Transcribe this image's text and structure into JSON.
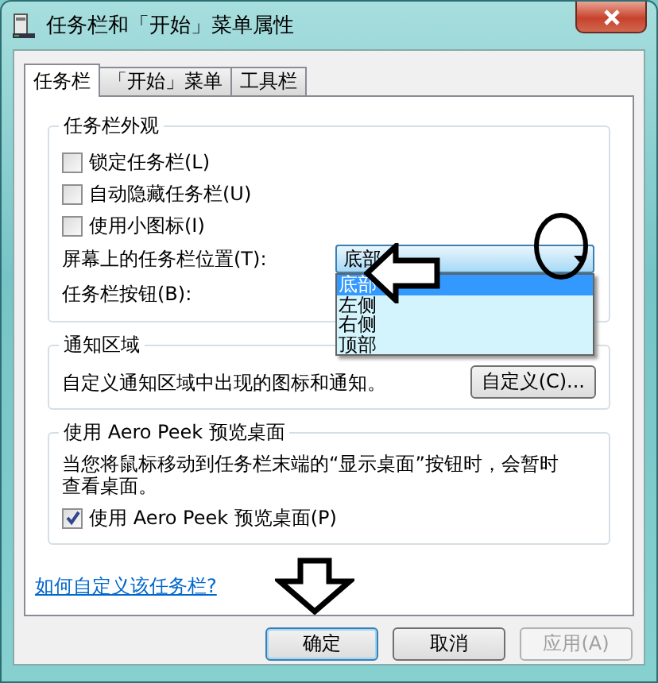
{
  "window": {
    "title": "任务栏和「开始」菜单属性"
  },
  "tabs": [
    {
      "label": "任务栏",
      "selected": true
    },
    {
      "label": "「开始」菜单",
      "selected": false
    },
    {
      "label": "工具栏",
      "selected": false
    }
  ],
  "appearance": {
    "title": "任务栏外观",
    "checkboxes": [
      {
        "label": "锁定任务栏(L)",
        "checked": false
      },
      {
        "label": "自动隐藏任务栏(U)",
        "checked": false
      },
      {
        "label": "使用小图标(I)",
        "checked": false
      }
    ],
    "position": {
      "label": "屏幕上的任务栏位置(T):",
      "value": "底部",
      "expanded": true,
      "options": [
        {
          "label": "底部",
          "selected": true
        },
        {
          "label": "左侧",
          "selected": false
        },
        {
          "label": "右侧",
          "selected": false
        },
        {
          "label": "顶部",
          "selected": false
        }
      ]
    },
    "buttons_label": "任务栏按钮(B):"
  },
  "notification_area": {
    "title": "通知区域",
    "description": "自定义通知区域中出现的图标和通知。",
    "button": "自定义(C)..."
  },
  "aero_peek": {
    "title": "使用 Aero Peek 预览桌面",
    "description": "当您将鼠标移动到任务栏末端的“显示桌面”按钮时，会暂时查看桌面。",
    "checkbox": {
      "label": "使用 Aero Peek 预览桌面(P)",
      "checked": true
    }
  },
  "help_link": "如何自定义该任务栏?",
  "buttons": [
    {
      "label": "确定",
      "disabled": false
    },
    {
      "label": "取消",
      "disabled": false
    },
    {
      "label": "应用(A)",
      "disabled": true
    }
  ],
  "annotations": [
    {
      "kind": "circle"
    },
    {
      "kind": "arrow-left"
    },
    {
      "kind": "arrow-down"
    }
  ]
}
